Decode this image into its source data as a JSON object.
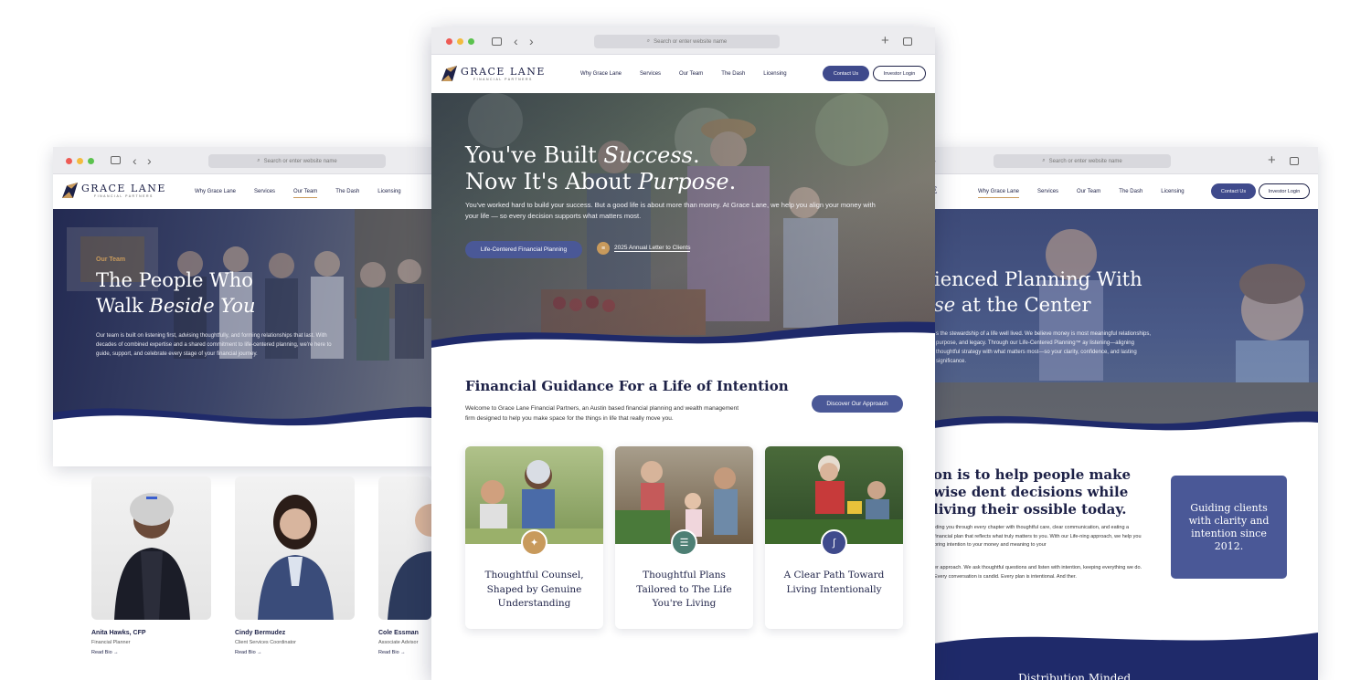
{
  "browser": {
    "address_placeholder": "Search or enter website name",
    "back_glyph": "‹",
    "forward_glyph": "›",
    "new_tab_glyph": "+",
    "search_glyph": "⌕"
  },
  "brand": {
    "name": "GRACE LANE",
    "tagline": "FINANCIAL PARTNERS",
    "colors": {
      "navy": "#1d2147",
      "accent_blue": "#3f4a8c",
      "gold": "#c89a5c",
      "teal": "#4d7f74"
    }
  },
  "nav": {
    "links": [
      "Why Grace Lane",
      "Services",
      "Our Team",
      "The Dash",
      "Licensing"
    ],
    "contact_label": "Contact Us",
    "investor_label": "Investor Login"
  },
  "left_page": {
    "eyebrow": "Our Team",
    "title_line1": "The People Who",
    "title_line2_plain": "Walk ",
    "title_line2_italic": "Beside You",
    "body": "Our team is built on listening first, advising thoughtfully, and forming relationships that last. With decades of combined expertise and a shared commitment to life-centered planning, we're here to guide, support, and celebrate every stage of your financial journey.",
    "members": [
      {
        "name": "Anita Hawks, CFP",
        "role": "Financial Planner",
        "link": "Read Bio"
      },
      {
        "name": "Cindy Bermudez",
        "role": "Client Services Coordinator",
        "link": "Read Bio"
      },
      {
        "name": "Cole Essman",
        "role": "Associate Advisor",
        "link": "Read Bio"
      }
    ],
    "arrow_glyph": "→"
  },
  "center_page": {
    "hero_line1_plain": "You've Built ",
    "hero_line1_italic": "Success",
    "hero_line1_end": ".",
    "hero_line2_plain": "Now It's About ",
    "hero_line2_italic": "Purpose",
    "hero_line2_end": ".",
    "hero_body": "You've worked hard to build your success. But a good life is about more than money. At Grace Lane, we help you align your money with your life — so every decision supports what matters most.",
    "hero_button": "Life-Centered Financial Planning",
    "letter_link": "2025 Annual Letter to Clients",
    "section_title": "Financial Guidance For a Life of Intention",
    "section_body": "Welcome to Grace Lane Financial Partners, an Austin based financial planning and wealth management firm designed to help you make space for the things in life that really move you.",
    "approach_button": "Discover Our Approach",
    "cards": [
      {
        "title": "Thoughtful Counsel, Shaped by Genuine Understanding",
        "icon": "compass-icon",
        "badge_color": "#c89a5c",
        "glyph": "✦"
      },
      {
        "title": "Thoughtful Plans Tailored to The Life You're Living",
        "icon": "checklist-icon",
        "badge_color": "#4d7f74",
        "glyph": "☰"
      },
      {
        "title": "A Clear Path Toward Living Intentionally",
        "icon": "path-icon",
        "badge_color": "#3f4a8c",
        "glyph": "∫"
      }
    ]
  },
  "right_page": {
    "hero_title_line1": "ienced Planning With",
    "hero_title_line2_italic": "se",
    "hero_title_line2_plain": " at the Center",
    "hero_body": "s the stewardship of a life well lived. We believe money is most meaningful relationships, purpose, and legacy. Through our Life-Centered Planning™ ay listening—aligning thoughtful strategy with what matters most—so your clarity, confidence, and lasting significance.",
    "mission_title": "on is to help people make wise dent decisions while living their ossible today.",
    "mission_p1": "iding you through every chapter with thoughtful care, clear communication, and eating a financial plan that reflects what truly matters to you. With our Life-ning approach, we help you bring intention to your money and meaning to your",
    "mission_p2": "er approach. We ask thoughtful questions and listen with intention, keeping everything we do. Every conversation is candid. Every plan is intentional. And ther.",
    "callout": "Guiding clients with clarity and intention since 2012.",
    "bottom_heading": "Distribution Minded"
  }
}
